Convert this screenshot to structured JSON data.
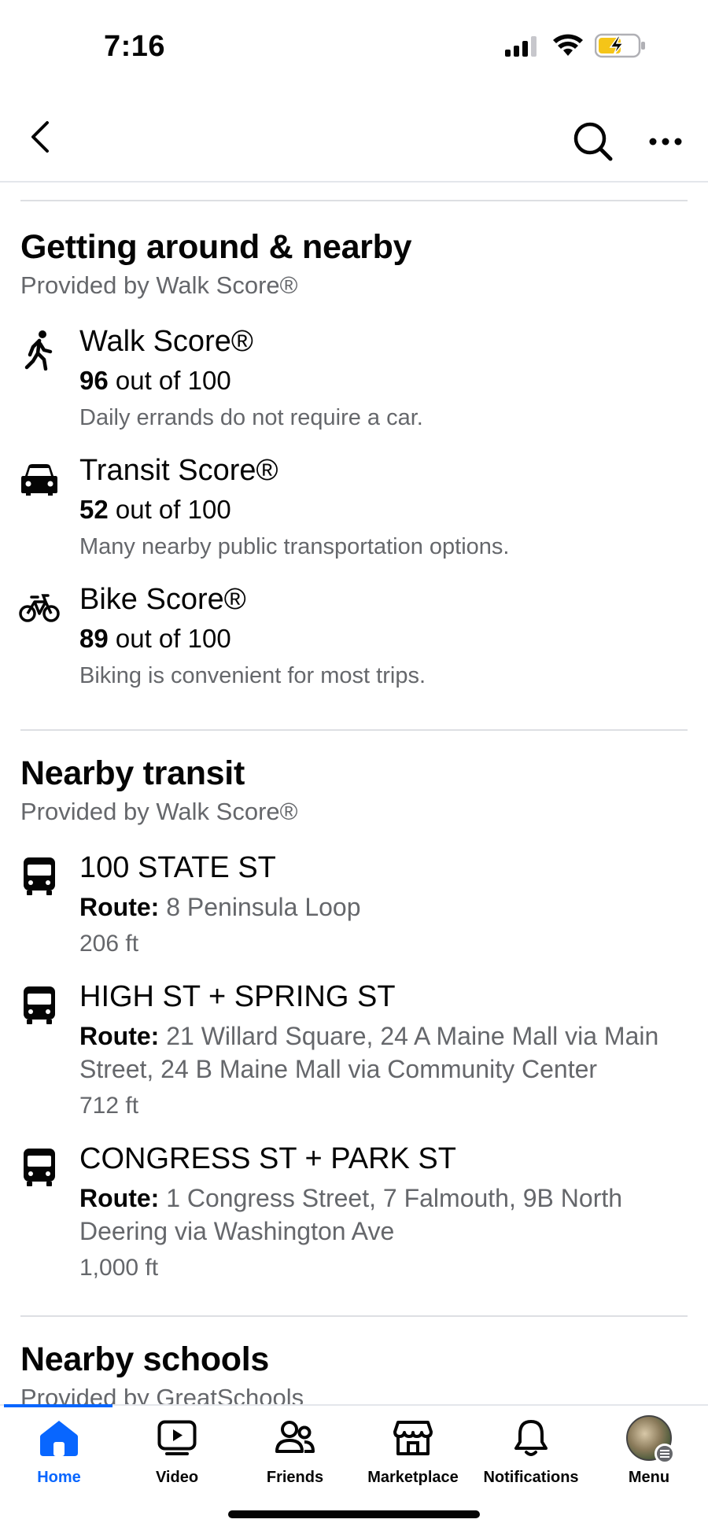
{
  "status_bar": {
    "time": "7:16"
  },
  "getting_around": {
    "title": "Getting around & nearby",
    "subtitle": "Provided by Walk Score®",
    "items": [
      {
        "icon": "walking-person-icon",
        "title": "Walk Score®",
        "score": "96",
        "score_suffix": " out of 100",
        "description": "Daily errands do not require a car."
      },
      {
        "icon": "car-icon",
        "title": "Transit Score®",
        "score": "52",
        "score_suffix": " out of 100",
        "description": "Many nearby public transportation options."
      },
      {
        "icon": "bicycle-icon",
        "title": "Bike Score®",
        "score": "89",
        "score_suffix": " out of 100",
        "description": "Biking is convenient for most trips."
      }
    ]
  },
  "nearby_transit": {
    "title": "Nearby transit",
    "subtitle": "Provided by Walk Score®",
    "route_label": "Route:",
    "stops": [
      {
        "icon": "bus-icon",
        "name": "100 STATE ST",
        "routes": " 8 Peninsula Loop",
        "distance": "206 ft"
      },
      {
        "icon": "bus-icon",
        "name": "HIGH ST + SPRING ST",
        "routes": " 21 Willard Square, 24 A Maine Mall via Main Street, 24 B Maine Mall via Community Center",
        "distance": "712 ft"
      },
      {
        "icon": "bus-icon",
        "name": "CONGRESS ST + PARK ST",
        "routes": " 1 Congress Street, 7 Falmouth, 9B North Deering via Washington Ave",
        "distance": "1,000 ft"
      }
    ]
  },
  "nearby_schools": {
    "title": "Nearby schools",
    "subtitle": "Provided by GreatSchools"
  },
  "tab_bar": {
    "active_color": "#0866ff",
    "tabs": [
      {
        "icon": "home-icon",
        "label": "Home",
        "active": true
      },
      {
        "icon": "video-icon",
        "label": "Video"
      },
      {
        "icon": "friends-icon",
        "label": "Friends"
      },
      {
        "icon": "marketplace-icon",
        "label": "Marketplace"
      },
      {
        "icon": "bell-icon",
        "label": "Notifications"
      },
      {
        "icon": "avatar",
        "label": "Menu"
      }
    ]
  }
}
